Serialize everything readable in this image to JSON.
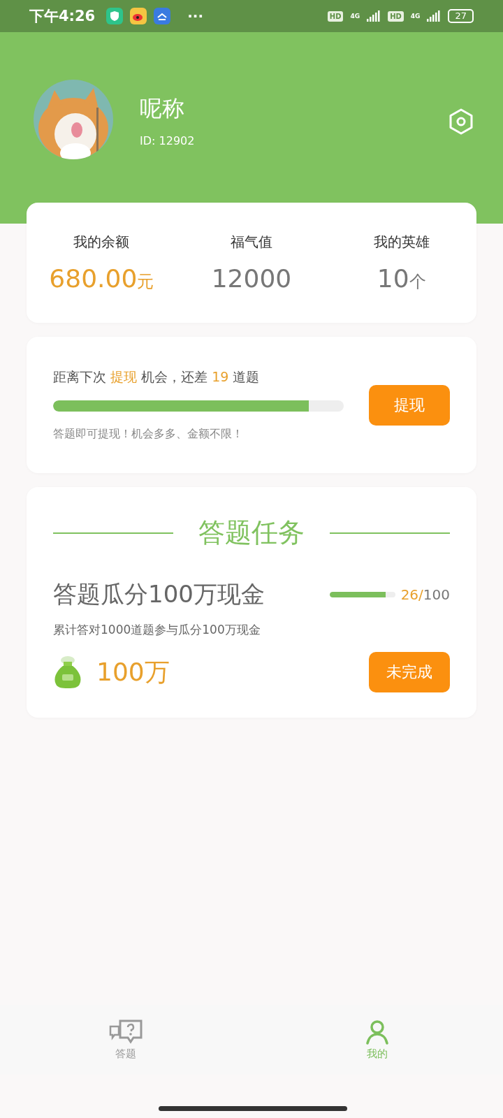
{
  "status_bar": {
    "time": "下午4:26",
    "more": "···",
    "sims": [
      {
        "hd": "HD",
        "network": "4G"
      },
      {
        "hd": "HD",
        "network": "4G"
      }
    ],
    "battery": "27"
  },
  "profile": {
    "nickname": "呢称",
    "id": "ID: 12902"
  },
  "stats": [
    {
      "label": "我的余额",
      "value": "680.00",
      "unit": "元",
      "highlight": true
    },
    {
      "label": "福气值",
      "value": "12000",
      "highlight": false
    },
    {
      "label": "我的英雄",
      "value": "10",
      "unit": "个",
      "highlight": false
    }
  ],
  "withdraw": {
    "prompt": [
      {
        "text": "距离下次 ",
        "highlight": false
      },
      {
        "text": "提现",
        "highlight": true
      },
      {
        "text": " 机会，还差 ",
        "highlight": false
      },
      {
        "text": "19",
        "highlight": true
      },
      {
        "text": " 道题",
        "highlight": false
      }
    ],
    "level": 0.88,
    "hint": "答题即可提现！机会多多、金额不限！",
    "button": "提现"
  },
  "tasks": {
    "title": "答题任务",
    "items": [
      {
        "name": "答题瓜分100万现金",
        "level": 0.85,
        "done": "26/",
        "total": "100",
        "description": "累计答对1000道题参与瓜分100万现金",
        "reward": "100万",
        "button": "未完成"
      }
    ]
  },
  "tabbar": [
    {
      "label": "答题",
      "selected": false,
      "kind": "quiz"
    },
    {
      "label": "我的",
      "selected": true,
      "kind": "me"
    }
  ]
}
